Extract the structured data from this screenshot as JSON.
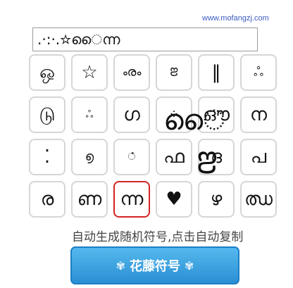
{
  "watermark": "www.mofangzj.com",
  "input": {
    "value": ".·:·.☆ൈന്ന"
  },
  "symbols": [
    "ஒ",
    "☆",
    "ൟ",
    "ꢂ",
    "‖",
    "ஃ",
    "டு",
    "ஃ",
    "ഗ",
    "⁘",
    "ഔ",
    "ന",
    "⁚",
    "൭",
    "ഀ",
    "ഫ",
    "ദ",
    "പ",
    "ര",
    "ണ",
    "ന്ന",
    "♥",
    "ഴ",
    "ഝ"
  ],
  "overlay": {
    "glyph_a": "ൈ",
    "glyph_b": "ꢂ"
  },
  "selected_index": 20,
  "caption": "自动生成随机符号,点击自动复制",
  "button": {
    "label": "花藤符号",
    "deco_left": "✾",
    "deco_right": "✾"
  },
  "colors": {
    "watermark": "#3b5bbf",
    "selected_border": "#d52424",
    "button_top": "#55b8ee",
    "button_bottom": "#2a8fd3"
  }
}
